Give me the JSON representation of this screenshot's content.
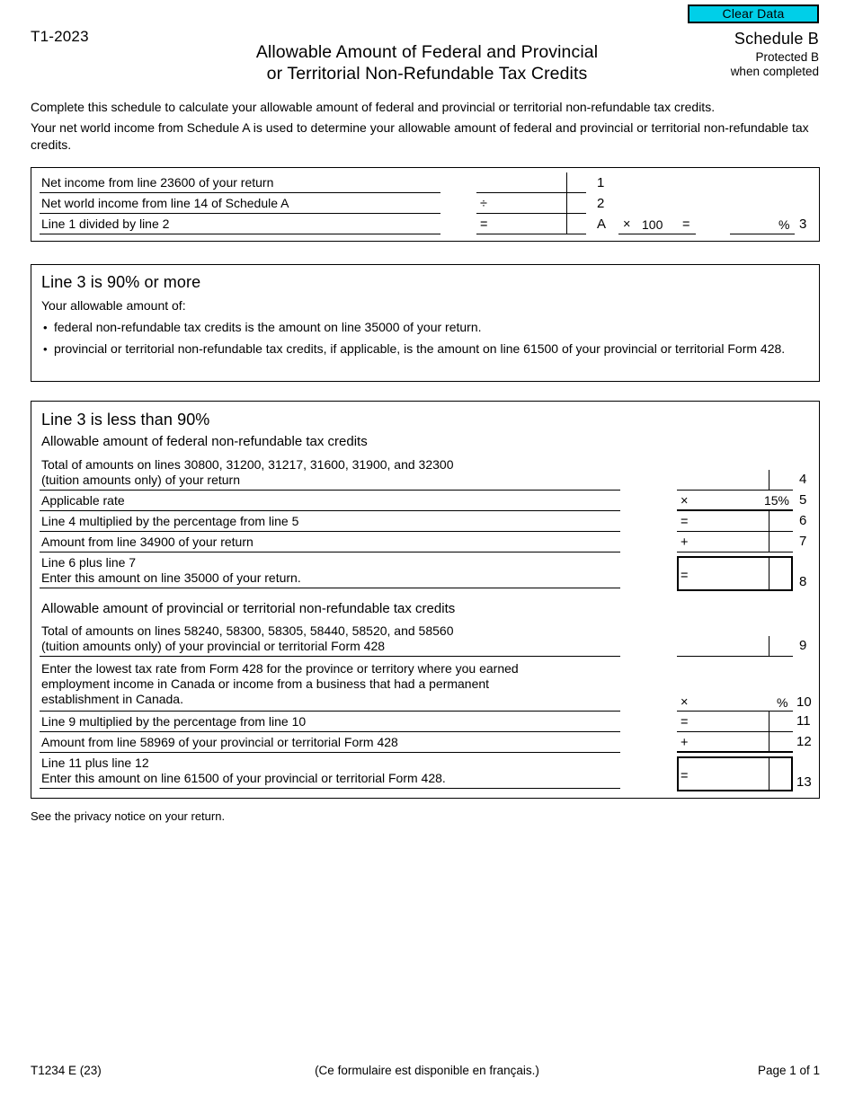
{
  "header": {
    "clear_data_label": "Clear Data",
    "clear_data_color": "#00CFE8",
    "form_id": "T1-2023",
    "title_line1": "Allowable Amount of Federal and Provincial",
    "title_line2": "or Territorial Non-Refundable Tax Credits",
    "schedule": "Schedule B",
    "protected": "Protected B",
    "when_completed": "when completed"
  },
  "intro": {
    "paragraph1": "Complete this schedule to calculate your allowable amount of federal and provincial or territorial non-refundable tax credits.",
    "paragraph2": "Your net world income from Schedule A is used to determine your allowable amount of federal and provincial or territorial non-refundable tax credits."
  },
  "calc_box": {
    "rows": [
      {
        "label": "Net income from line 23600 of your return",
        "op": "",
        "value": "",
        "number": "1"
      },
      {
        "label": "Net world income from line 14 of Schedule A",
        "op": "÷",
        "value": "",
        "number": "2"
      },
      {
        "label": "Line 1 divided by line 2",
        "op": "=",
        "value": "",
        "number": "3"
      }
    ],
    "marker_a": "A",
    "multiply_sign": "×",
    "multiplier": "100",
    "equals_sign": "=",
    "percent_sign": "%",
    "percent_value": ""
  },
  "section_90_or_more": {
    "heading": "Line 3 is 90% or more",
    "intro": "Your allowable amount of:",
    "bullet_char": "•",
    "bullets": [
      "federal non-refundable tax credits is the amount on line 35000 of your return.",
      "provincial or territorial non-refundable tax credits, if applicable, is the amount on line 61500 of your provincial or territorial Form 428."
    ]
  },
  "section_less_than_90": {
    "heading": "Line 3 is less than 90%",
    "sub_heading_federal": "Allowable amount of federal non-refundable tax credits",
    "sub_heading_provincial": "Allowable amount of provincial or territorial non-refundable tax credits",
    "line4_label_a": "Total of amounts on lines 30800, 31200, 31217, 31600, 31900, and 32300",
    "line4_label_b": "(tuition amounts only) of your return",
    "line4_number": "4",
    "line4_value": "",
    "line5_label": "Applicable rate",
    "line5_op": "×",
    "line5_value": "15%",
    "line5_number": "5",
    "line6_label": "Line 4 multiplied by the percentage from line 5",
    "line6_op": "=",
    "line6_value": "",
    "line6_number": "6",
    "line7_label": "Amount from line 34900 of your return",
    "line7_op": "+",
    "line7_value": "",
    "line7_number": "7",
    "line8_label_a": "Line 6 plus line 7",
    "line8_label_b": "Enter this amount on line 35000 of your return.",
    "line8_op": "=",
    "line8_value": "",
    "line8_number": "8",
    "line9_label_a": "Total of amounts on lines 58240, 58300, 58305, 58440, 58520, and 58560",
    "line9_label_b": "(tuition amounts only) of your provincial or territorial Form 428",
    "line9_number": "9",
    "line9_value": "",
    "line10_label_a": "Enter the lowest tax rate from Form 428 for the province or territory where you earned",
    "line10_label_b": "employment income in Canada or income from a business that had a permanent",
    "line10_label_c": "establishment in Canada.",
    "line10_op": "×",
    "line10_percent": "%",
    "line10_value": "",
    "line10_number": "10",
    "line11_label": "Line 9 multiplied by the percentage from line 10",
    "line11_op": "=",
    "line11_value": "",
    "line11_number": "11",
    "line12_label": "Amount from line 58969 of your provincial or territorial Form 428",
    "line12_op": "+",
    "line12_value": "",
    "line12_number": "12",
    "line13_label_a": "Line 11 plus line 12",
    "line13_label_b": "Enter this amount on line 61500 of your provincial or territorial Form 428.",
    "line13_op": "=",
    "line13_value": "",
    "line13_number": "13"
  },
  "footer": {
    "privacy_notice": "See the privacy notice on your return.",
    "form_code": "T1234 E (23)",
    "french_note": "(Ce formulaire est disponible en français.)",
    "page_number": "Page 1 of 1"
  }
}
